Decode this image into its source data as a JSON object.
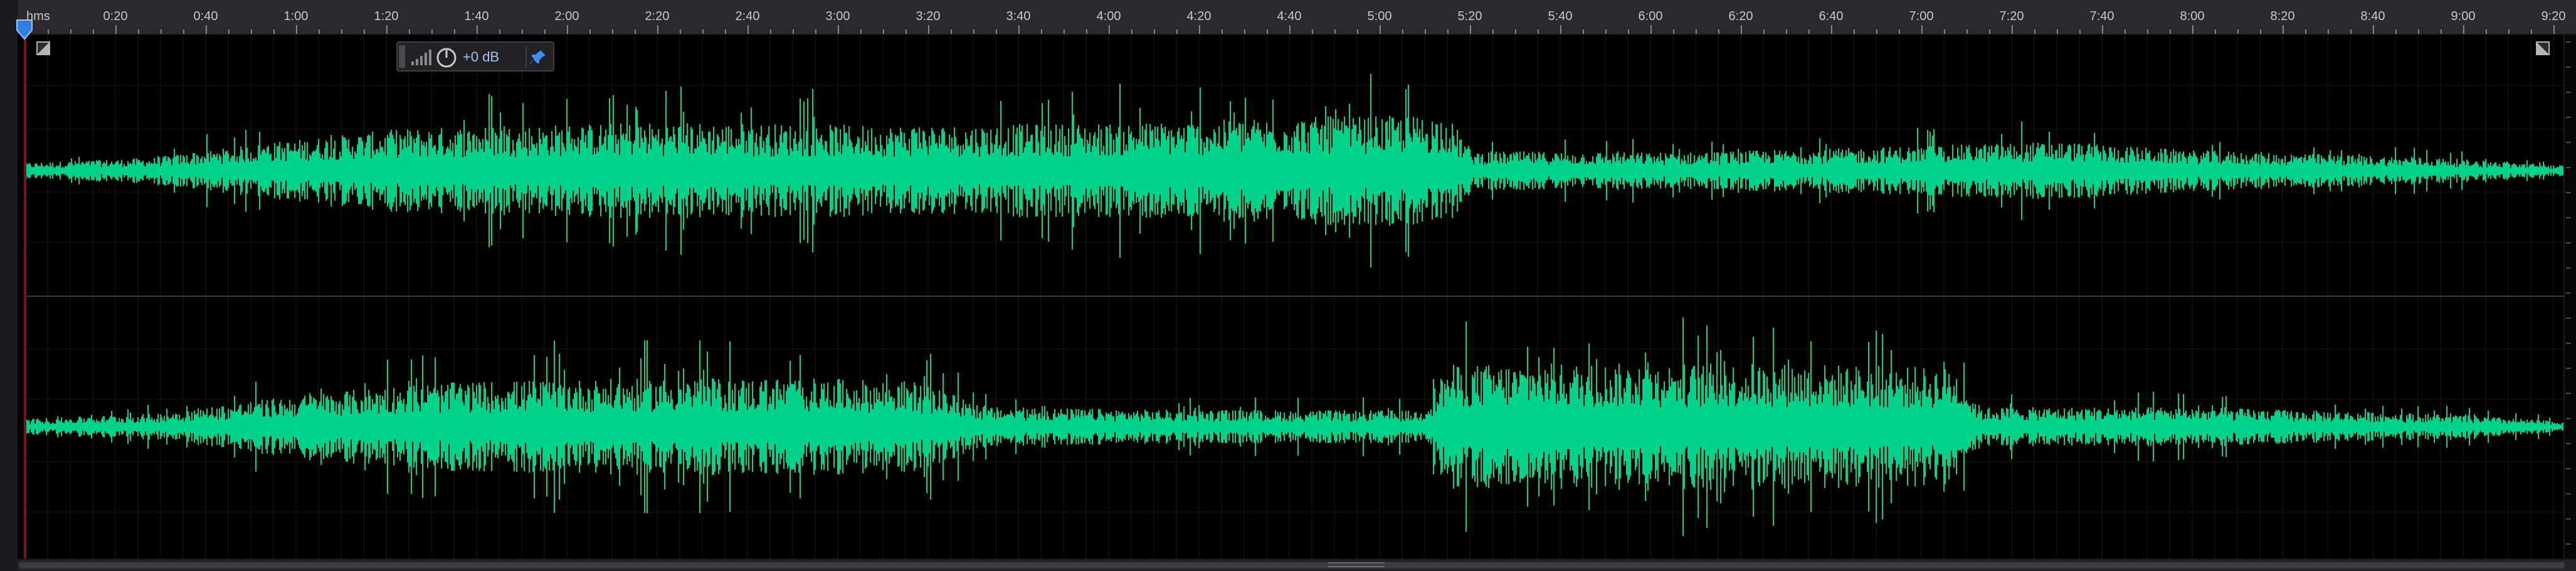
{
  "ruler": {
    "unit_label": "hms",
    "labels": [
      "0:20",
      "0:40",
      "1:00",
      "1:20",
      "1:40",
      "2:00",
      "2:20",
      "2:40",
      "3:00",
      "3:20",
      "3:40",
      "4:00",
      "4:20",
      "4:40",
      "5:00",
      "5:20",
      "5:40",
      "6:00",
      "6:20",
      "6:40",
      "7:00",
      "7:20",
      "7:40",
      "8:00",
      "8:20",
      "8:40",
      "9:00",
      "9:20"
    ]
  },
  "hud": {
    "volume": "+0 dB"
  },
  "icons": {
    "playhead": "playhead-marker-icon",
    "meter": "level-meter-icon",
    "knob": "volume-knob-icon",
    "pin": "pin-icon",
    "fade_in": "fade-in-handle-icon",
    "fade_out": "fade-out-handle-icon"
  },
  "colors": {
    "waveform": "#00d38c",
    "background": "#000000",
    "ruler_bg": "#2a2a2e",
    "playhead": "#2f7fe0",
    "hud_text": "#9fc4e8"
  }
}
